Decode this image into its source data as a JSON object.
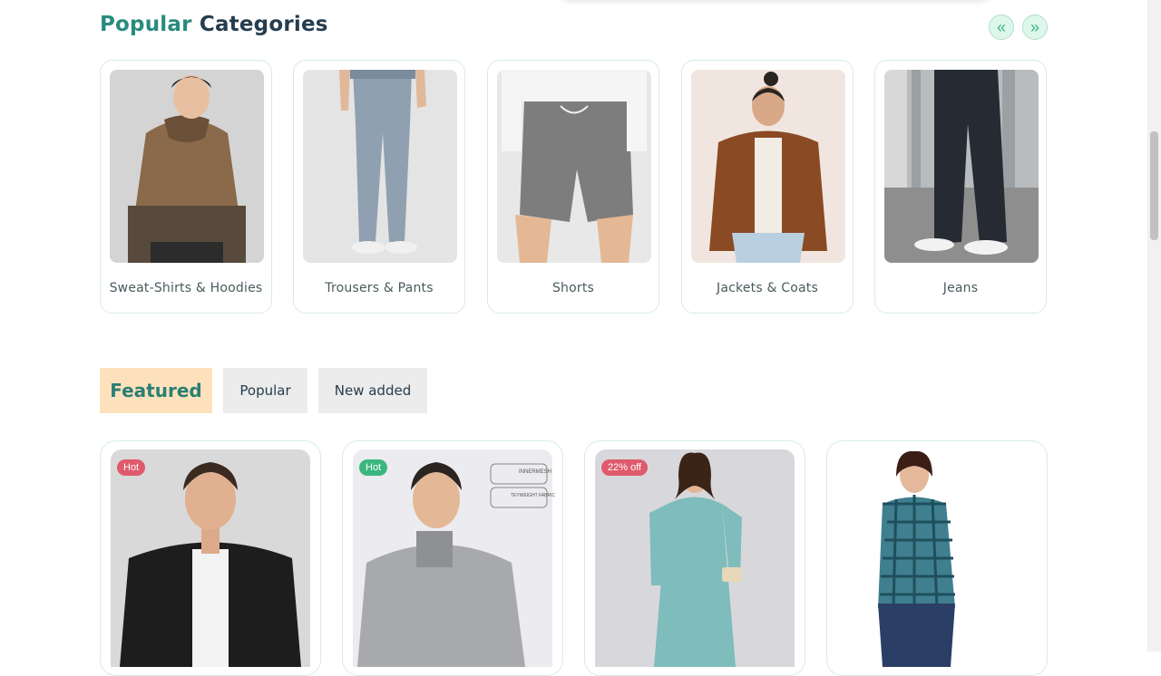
{
  "section": {
    "title_accent": "Popular",
    "title_rest": "Categories",
    "prev_icon": "double-chevron-left-icon",
    "next_icon": "double-chevron-right-icon",
    "prev_glyph": "«",
    "next_glyph": "»"
  },
  "categories": [
    {
      "label": "Sweat-Shirts & Hoodies",
      "image": "hoodie-photo"
    },
    {
      "label": "Trousers & Pants",
      "image": "trousers-photo"
    },
    {
      "label": "Shorts",
      "image": "shorts-photo"
    },
    {
      "label": "Jackets & Coats",
      "image": "jacket-photo"
    },
    {
      "label": "Jeans",
      "image": "jeans-photo"
    }
  ],
  "tabs": {
    "featured": "Featured",
    "popular": "Popular",
    "new_added": "New added"
  },
  "products": [
    {
      "badge": "Hot",
      "badge_color": "#e05a6d",
      "image": "black-denim-jacket-photo"
    },
    {
      "badge": "Hot",
      "badge_color": "#3bb77e",
      "image": "grey-track-jacket-photo"
    },
    {
      "badge": "22% off",
      "badge_color": "#e05a6d",
      "image": "teal-kurta-photo"
    },
    {
      "badge": "",
      "badge_color": "",
      "image": "checked-shirt-photo"
    }
  ],
  "product_image_text": {
    "tag1": "INNERMESH",
    "tag2": "TEYWEIGHT FABRIC"
  },
  "colors": {
    "accent": "#2a8a7f",
    "featured_tab_bg": "#fde1bd",
    "hot_red": "#e05a6d",
    "hot_green": "#3bb77e"
  }
}
